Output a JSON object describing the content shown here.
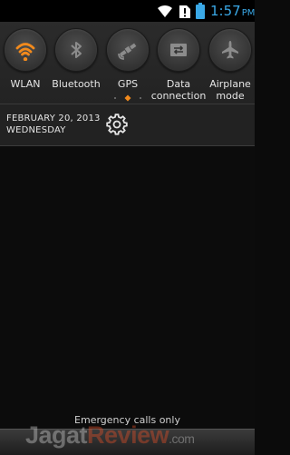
{
  "status_bar": {
    "time": "1:57",
    "ampm": "PM",
    "icons": [
      "wifi-icon",
      "sim-alert-icon",
      "battery-icon"
    ],
    "time_color": "#3aa8e6"
  },
  "quick_toggles": [
    {
      "label": "WLAN",
      "icon": "wifi-icon",
      "active": true
    },
    {
      "label": "Bluetooth",
      "icon": "bluetooth-icon",
      "active": false
    },
    {
      "label": "GPS",
      "icon": "gps-satellite-icon",
      "active": false
    },
    {
      "label_line1": "Data",
      "label_line2": "connection",
      "icon": "data-connection-icon",
      "active": false
    },
    {
      "label_line1": "Airplane",
      "label_line2": "mode",
      "icon": "airplane-icon",
      "active": false
    }
  ],
  "accent_color": "#f28a1c",
  "date": {
    "line1": "FEBRUARY 20, 2013",
    "line2": "WEDNESDAY"
  },
  "footer": {
    "emergency_text": "Emergency calls only",
    "watermark_part1": "Jagat",
    "watermark_part2": "Review",
    "watermark_part3": ".com"
  }
}
